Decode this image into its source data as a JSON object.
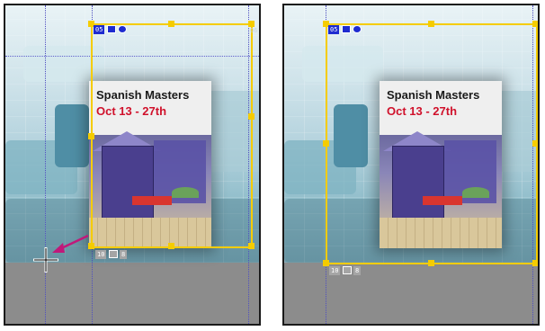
{
  "panels": [
    {
      "card": {
        "title": "Spanish Masters",
        "date": "Oct 13 - 27th"
      },
      "top_labels": {
        "index": "05",
        "corner": "06"
      },
      "bottom_labels": {
        "index": "10",
        "count": "8"
      }
    },
    {
      "card": {
        "title": "Spanish Masters",
        "date": "Oct 13 - 27th"
      },
      "top_labels": {
        "index": "05"
      },
      "bottom_labels": {
        "index": "10",
        "count": "8"
      }
    }
  ],
  "colors": {
    "frame": "#f5cc00",
    "arrow": "#c0187a",
    "tag": "#1e2bd0",
    "date_text": "#d0112b"
  },
  "icons": [
    "image-frame-icon",
    "link-icon",
    "resize-arrow-icon",
    "crosshair-cursor-icon"
  ]
}
